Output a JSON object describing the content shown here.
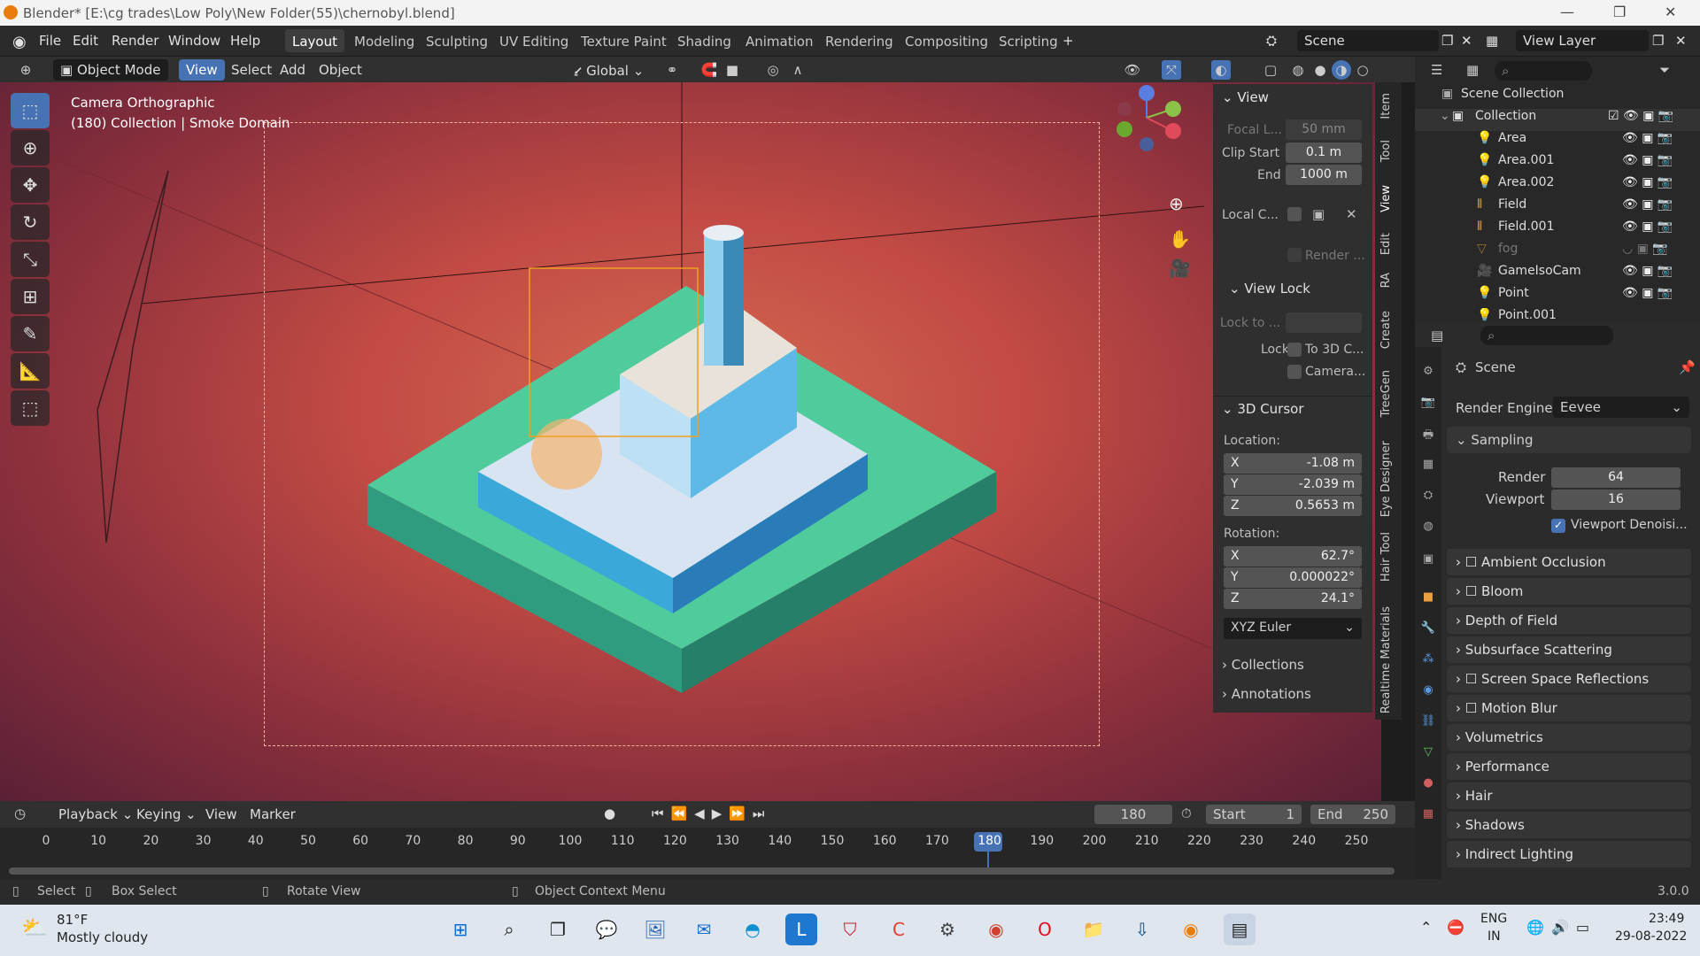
{
  "title": "Blender* [E:\\cg trades\\Low Poly\\New Folder(55)\\chernobyl.blend]",
  "menu": [
    "File",
    "Edit",
    "Render",
    "Window",
    "Help"
  ],
  "workspaces": [
    "Layout",
    "Modeling",
    "Sculpting",
    "UV Editing",
    "Texture Paint",
    "Shading",
    "Animation",
    "Rendering",
    "Compositing",
    "Scripting"
  ],
  "scene": "Scene",
  "view_layer": "View Layer",
  "vp": {
    "mode": "Object Mode",
    "view": "View",
    "select": "Select",
    "add": "Add",
    "object": "Object",
    "orientation": "Global"
  },
  "vpinfo": {
    "line1": "Camera Orthographic",
    "line2": "(180) Collection | Smoke Domain"
  },
  "npanel": {
    "view_title": "View",
    "focal_label": "Focal L...",
    "focal": "50 mm",
    "clip_start_label": "Clip Start",
    "clip_start": "0.1 m",
    "end_label": "End",
    "end": "1000 m",
    "localc": "Local C...",
    "render": "Render ...",
    "viewlock_title": "View Lock",
    "lockto": "Lock to ...",
    "lock": "Lock",
    "to3dc": "To 3D C...",
    "camera": "Camera...",
    "cursor_title": "3D Cursor",
    "location": "Location:",
    "lx": "-1.08 m",
    "ly": "-2.039 m",
    "lz": "0.5653 m",
    "rotation": "Rotation:",
    "rx": "62.7°",
    "ry": "0.000022°",
    "rz": "24.1°",
    "euler": "XYZ Euler",
    "collections": "Collections",
    "annotations": "Annotations",
    "x": "X",
    "y": "Y",
    "z": "Z"
  },
  "vtabs": [
    "Item",
    "Tool",
    "View",
    "Edit",
    "RA",
    "Create",
    "TreeGen",
    "Eye Designer",
    "Hair Tool",
    "Realtime Materials"
  ],
  "outliner": {
    "scene_collection": "Scene Collection",
    "collection": "Collection",
    "items": [
      "Area",
      "Area.001",
      "Area.002",
      "Field",
      "Field.001",
      "fog",
      "GameIsoCam",
      "Point",
      "Point.001"
    ]
  },
  "props": {
    "scene": "Scene",
    "render_engine_label": "Render Engine",
    "render_engine": "Eevee",
    "sampling": "Sampling",
    "render_label": "Render",
    "render": "64",
    "viewport_label": "Viewport",
    "viewport": "16",
    "denoise": "Viewport Denoisi...",
    "sections": [
      "Ambient Occlusion",
      "Bloom",
      "Depth of Field",
      "Subsurface Scattering",
      "Screen Space Reflections",
      "Motion Blur",
      "Volumetrics",
      "Performance",
      "Hair",
      "Shadows",
      "Indirect Lighting"
    ]
  },
  "timeline": {
    "playback": "Playback",
    "keying": "Keying",
    "view": "View",
    "marker": "Marker",
    "frame": "180",
    "start_label": "Start",
    "start": "1",
    "end_label": "End",
    "end": "250",
    "ticks": [
      "0",
      "10",
      "20",
      "30",
      "40",
      "50",
      "60",
      "70",
      "80",
      "90",
      "100",
      "110",
      "120",
      "130",
      "140",
      "150",
      "160",
      "170",
      "180",
      "190",
      "200",
      "210",
      "220",
      "230",
      "240",
      "250"
    ]
  },
  "status": {
    "select": "Select",
    "box_select": "Box Select",
    "rotate": "Rotate View",
    "context": "Object Context Menu",
    "version": "3.0.0"
  },
  "taskbar": {
    "temp": "81°F",
    "weather": "Mostly cloudy",
    "lang1": "ENG",
    "lang2": "IN",
    "time": "23:49",
    "date": "29-08-2022"
  }
}
